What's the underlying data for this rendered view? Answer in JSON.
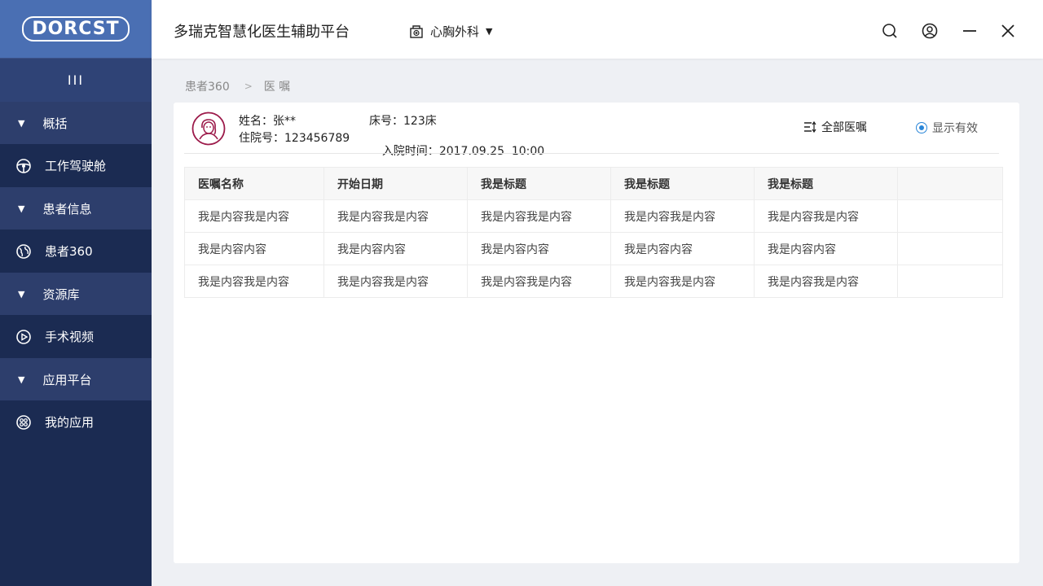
{
  "sidebar": {
    "logo": "DORCST",
    "collapse_icon": "III",
    "items": [
      {
        "type": "group",
        "label": "概括"
      },
      {
        "type": "item",
        "label": "工作驾驶舱",
        "icon": "steering-wheel-icon"
      },
      {
        "type": "group",
        "label": "患者信息"
      },
      {
        "type": "item",
        "label": "患者360",
        "icon": "globe-icon"
      },
      {
        "type": "group",
        "label": "资源库"
      },
      {
        "type": "item",
        "label": "手术视频",
        "icon": "play-icon"
      },
      {
        "type": "group",
        "label": "应用平台"
      },
      {
        "type": "item",
        "label": "我的应用",
        "icon": "apps-icon"
      }
    ]
  },
  "header": {
    "title": "多瑞克智慧化医生辅助平台",
    "department": "心胸外科"
  },
  "breadcrumb": {
    "parent": "患者360",
    "current": "医 嘱"
  },
  "patient": {
    "name_label": "姓名：",
    "name": "张**",
    "bed_label": "床号：",
    "bed": "123床",
    "admission_label": "住院号：",
    "admission_no": "123456789",
    "admit_time_label": "入院时间：",
    "admit_time": "2017.09.25  10:00"
  },
  "actions": {
    "all_orders": "全部医嘱",
    "show_valid": "显示有效"
  },
  "table": {
    "headers": [
      "医嘱名称",
      "开始日期",
      "我是标题",
      "我是标题",
      "我是标题",
      ""
    ],
    "rows": [
      [
        "我是内容我是内容",
        "我是内容我是内容",
        "我是内容我是内容",
        "我是内容我是内容",
        "我是内容我是内容",
        ""
      ],
      [
        "我是内容内容",
        "我是内容内容",
        "我是内容内容",
        "我是内容内容",
        "我是内容内容",
        ""
      ],
      [
        "我是内容我是内容",
        "我是内容我是内容",
        "我是内容我是内容",
        "我是内容我是内容",
        "我是内容我是内容",
        ""
      ]
    ]
  },
  "colors": {
    "sidebar_bg": "#1b2b52",
    "sidebar_group_bg": "#2d3e6c",
    "logo_bg": "#4a6fb3",
    "accent": "#2a86d8",
    "avatar": "#9c1a4a"
  }
}
